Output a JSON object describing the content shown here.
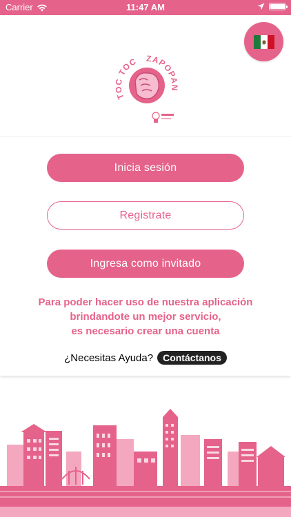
{
  "status_bar": {
    "carrier": "Carrier",
    "time": "11:47 AM",
    "battery_level": 0.95
  },
  "language": {
    "flag_icon": "mexico-flag-icon"
  },
  "logo": {
    "arc_text_left": "TOC TOC",
    "arc_text_right": "ZAPOPAN"
  },
  "buttons": {
    "login": "Inicia sesión",
    "register": "Registrate",
    "guest": "Ingresa como invitado"
  },
  "info": {
    "line1": "Para poder hacer uso de nuestra aplicación",
    "line2": "brindandote un mejor servicio,",
    "line3": "es necesario crear una cuenta"
  },
  "help": {
    "question": "¿Necesitas Ayuda?",
    "contact": "Contáctanos"
  },
  "colors": {
    "accent": "#e5638a",
    "accent_light": "#f4a8bf",
    "dark_pill": "#222222"
  },
  "icons": [
    "wifi-icon",
    "location-arrow-icon",
    "battery-icon",
    "mexico-flag-icon",
    "knocking-fist-logo-icon",
    "city-skyline-illustration"
  ]
}
